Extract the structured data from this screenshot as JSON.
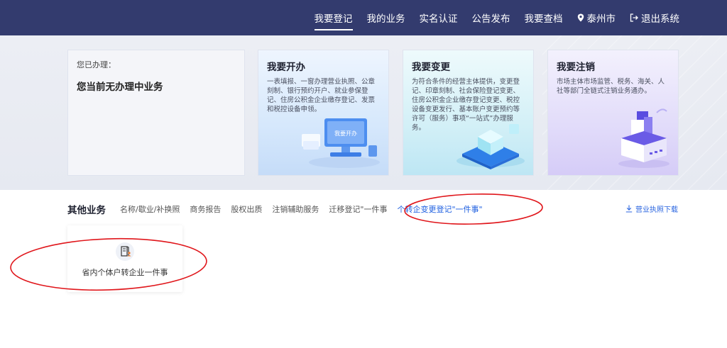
{
  "nav": {
    "items": [
      {
        "label": "我要登记",
        "active": true
      },
      {
        "label": "我的业务"
      },
      {
        "label": "实名认证"
      },
      {
        "label": "公告发布"
      },
      {
        "label": "我要查档"
      }
    ],
    "location": "泰州市",
    "logout": "退出系统"
  },
  "status_card": {
    "label": "您已办理：",
    "value": "您当前无办理中业务"
  },
  "services": [
    {
      "title": "我要开办",
      "desc": "一表填报、一窗办理营业执照、公章刻制、银行预约开户、就业参保登记、住房公积金企业缴存登记、发票和税控设备申领。",
      "illus_text": "我要开办"
    },
    {
      "title": "我要变更",
      "desc": "为符合条件的经营主体提供，变更登记、印章刻制、社会保险登记变更、住房公积金企业缴存登记变更、税控设备变更发行、基本账户变更预约等许可（服务）事项“一站式”办理服务。"
    },
    {
      "title": "我要注销",
      "desc": "市场主体市场监管、税务、海关、人社等部门全链式注销业务通办。"
    }
  ],
  "other": {
    "title": "其他业务",
    "tabs": [
      {
        "label": "名称/歇业/补换照"
      },
      {
        "label": "商务报告"
      },
      {
        "label": "股权出质"
      },
      {
        "label": "注销辅助服务"
      },
      {
        "label": "迁移登记\"一件事"
      },
      {
        "label": "个转企变更登记\"一件事\"",
        "active": true
      }
    ],
    "download": "营业执照下载"
  },
  "item_card": {
    "label": "省内个体户转企业一件事"
  },
  "colors": {
    "nav_bg": "#333b6e",
    "active_tab": "#1e5fe0",
    "annotation": "#e0161b"
  }
}
